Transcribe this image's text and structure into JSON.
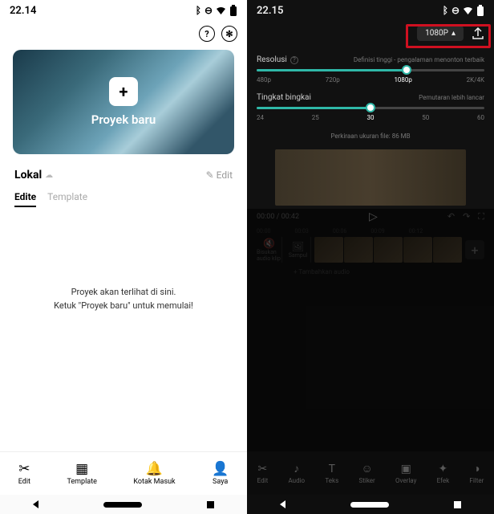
{
  "left": {
    "status_time": "22.14",
    "card_label": "Proyek baru",
    "lokal_label": "Lokal",
    "edit_label": "Edit",
    "tabs": {
      "edit": "Edite",
      "template": "Template"
    },
    "empty_line1": "Proyek akan terlihat di sini.",
    "empty_line2": "Ketuk \"Proyek baru\" untuk memulai!",
    "nav": {
      "edit": "Edit",
      "template": "Template",
      "kotak": "Kotak Masuk",
      "saya": "Saya"
    }
  },
  "right": {
    "status_time": "22.15",
    "res_btn": "1080P",
    "resolusi": {
      "label": "Resolusi",
      "hint": "Definisi tinggi - pengalaman menonton terbaik",
      "ticks": [
        "480p",
        "720p",
        "1080p",
        "2K/4K"
      ]
    },
    "bingkai": {
      "label": "Tingkat bingkai",
      "hint": "Pemutaran lebih lancar",
      "ticks": [
        "24",
        "25",
        "30",
        "50",
        "60"
      ]
    },
    "filesize": "Perkiraan ukuran file: 86 MB",
    "time_current": "00:00",
    "time_total": "00:42",
    "time_ticks": [
      "00:00",
      "00:03",
      "00:06",
      "00:09",
      "00:12"
    ],
    "side_btns": {
      "audio": "Bisukan audio klip",
      "sampul": "Sampul"
    },
    "add_audio": "+  Tambahkan audio",
    "nav": {
      "edit": "Edit",
      "audio": "Audio",
      "teks": "Teks",
      "stiker": "Stiker",
      "overlay": "Overlay",
      "efek": "Efek",
      "filter": "Filter"
    }
  }
}
